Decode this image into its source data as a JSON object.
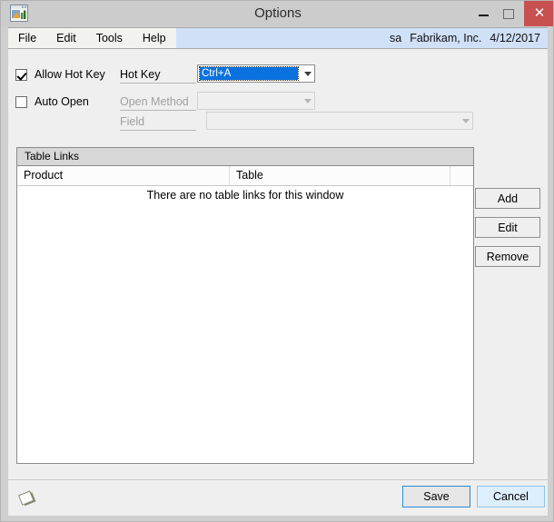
{
  "window": {
    "title": "Options",
    "icon": "window-chart-icon",
    "controls": {
      "minimize": "minimize-icon",
      "maximize": "maximize-icon",
      "close": "✕"
    }
  },
  "menubar": {
    "items": [
      {
        "label": "File"
      },
      {
        "label": "Edit"
      },
      {
        "label": "Tools"
      },
      {
        "label": "Help"
      }
    ],
    "status": {
      "user": "sa",
      "company": "Fabrikam, Inc.",
      "date": "4/12/2017"
    }
  },
  "options": {
    "allow_hot_key": {
      "label": "Allow Hot Key",
      "checked": true
    },
    "auto_open": {
      "label": "Auto Open",
      "checked": false
    },
    "hot_key": {
      "label": "Hot Key",
      "value": "Ctrl+A",
      "enabled": true
    },
    "open_method": {
      "label": "Open Method",
      "value": "",
      "enabled": false
    },
    "field": {
      "label": "Field",
      "value": "",
      "enabled": false
    }
  },
  "table_links": {
    "group_title": "Table Links",
    "columns": [
      "Product",
      "Table",
      ""
    ],
    "rows": [],
    "empty_message": "There are no table links for this window"
  },
  "side_buttons": {
    "add": "Add",
    "edit": "Edit",
    "remove": "Remove"
  },
  "footer": {
    "note_icon": "note-icon",
    "save": "Save",
    "cancel": "Cancel"
  },
  "colors": {
    "selection_blue": "#0a72df",
    "status_bar_blue": "#cfe0f7",
    "close_red": "#c75050",
    "default_button_border": "#2a8ad4",
    "hover_button_border": "#8ec4ea"
  }
}
